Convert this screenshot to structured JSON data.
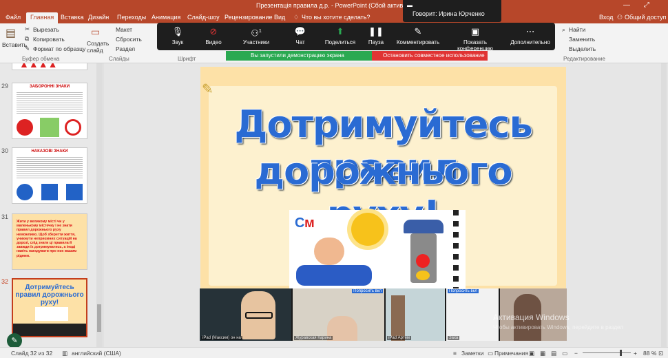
{
  "titlebar": {
    "title": "Презентація правила д.р. - PowerPoint (Сбой активации прод",
    "minimize": "—",
    "restore": "⤢"
  },
  "tabs": {
    "file": "Файл",
    "home": "Главная",
    "insert": "Вставка",
    "design": "Дизайн",
    "transitions": "Переходы",
    "animation": "Анимация",
    "slideshow": "Слайд-шоу",
    "review": "Рецензирование",
    "view": "Вид",
    "tellme": "Что вы хотите сделать?",
    "login": "Вход",
    "share": "Общий доступ"
  },
  "ribbon": {
    "paste": "Вставить",
    "cut": "Вырезать",
    "copy": "Копировать",
    "format_painter": "Формат по образцу",
    "clipboard": "Буфер обмена",
    "new_slide": "Создать слайд",
    "layout": "Макет",
    "reset": "Сбросить",
    "section": "Раздел",
    "slides": "Слайды",
    "font": "Шрифт",
    "find": "Найти",
    "replace": "Заменить",
    "select": "Выделить",
    "editing": "Редактирование"
  },
  "zoom": {
    "audio": "Звук",
    "video": "Видео",
    "participants": "Участники",
    "participants_count": "1",
    "chat": "Чат",
    "share": "Поделиться",
    "pause": "Пауза",
    "annotate": "Комментировать",
    "show_conf": "Показать конференцию",
    "more": "Дополнительно",
    "sharing_notice": "Вы запустили демонстрацию экрана",
    "stop_share": "Остановить совместное использование",
    "speaker": "Говорит: Ирина Юрченко"
  },
  "thumbnails": {
    "s29": {
      "num": "29",
      "title": "ЗАБОРОННІ ЗНАКИ"
    },
    "s30": {
      "num": "30",
      "title": "НАКАЗОВІ ЗНАКИ"
    },
    "s31": {
      "num": "31",
      "text": "Жити у великому місті чи у маленькому містечку і не знати правил дорожнього руху неможливо. Щоб зберегти життя, уникнути неприємних ситуацій на дорозі, слід знати ці правила й завжди їх дотримуватись, а іноді навіть нагадувати про них вашим рідним."
    },
    "s32": {
      "num": "32",
      "title": "Дотримуйтесь правил дорожнього руху!"
    }
  },
  "slide": {
    "line1": "Дотримуйтесь правил",
    "line2": "дорожнього руху!"
  },
  "video": {
    "tile1": "iPad (Максим) он на",
    "tile2": "Журавская Карина",
    "tile3": "iPad Артем",
    "tile4": "Заха",
    "ask_btn": "Попросить вкл"
  },
  "watermark": {
    "line1": "Активация Windows",
    "line2": "Чтобы активировать Windows, перейдите в раздел"
  },
  "status": {
    "slide_info": "Слайд 32 из 32",
    "language": "английский (США)",
    "notes": "Заметки",
    "comments": "Примечания",
    "zoom": "88 %"
  },
  "colors": {
    "accent": "#b7472a",
    "zoom_green": "#2aa952",
    "stop_red": "#e03434"
  }
}
